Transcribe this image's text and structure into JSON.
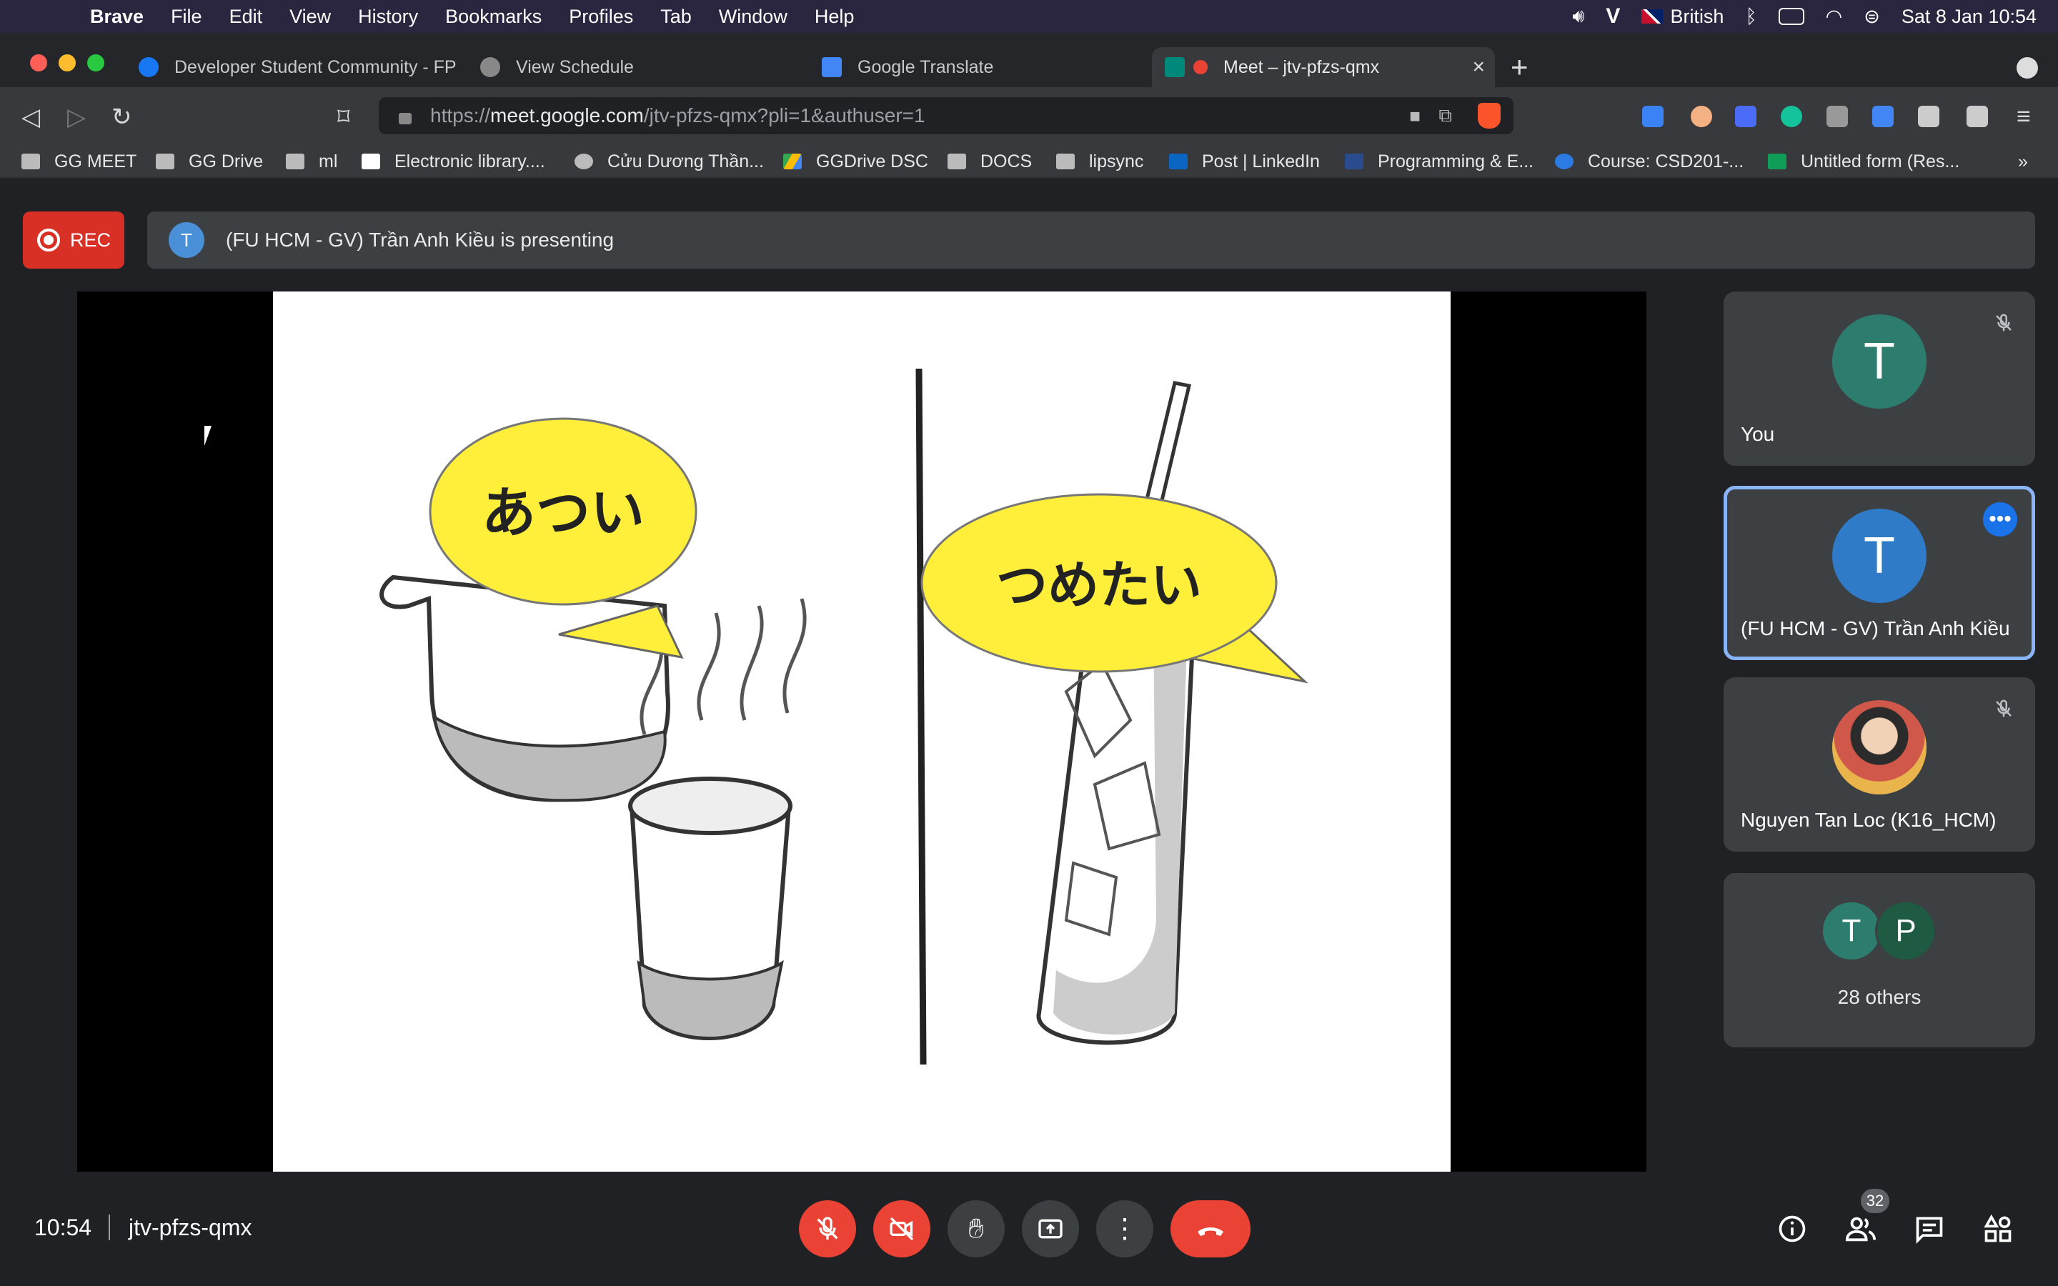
{
  "menubar": {
    "app": "Brave",
    "items": [
      "File",
      "Edit",
      "View",
      "History",
      "Bookmarks",
      "Profiles",
      "Tab",
      "Window",
      "Help"
    ],
    "language": "British",
    "datetime": "Sat 8 Jan  10:54"
  },
  "tabs": [
    {
      "title": "Developer Student Community - FP"
    },
    {
      "title": "View Schedule"
    },
    {
      "title": "Google Translate"
    },
    {
      "title": "Meet – jtv-pfzs-qmx"
    }
  ],
  "address": {
    "prefix": "https://",
    "host": "meet.google.com",
    "path": "/jtv-pfzs-qmx?pli=1&authuser=1"
  },
  "bookmarks": [
    {
      "label": "GG MEET"
    },
    {
      "label": "GG Drive"
    },
    {
      "label": "ml"
    },
    {
      "label": "Electronic library...."
    },
    {
      "label": "Cửu Dương Thần..."
    },
    {
      "label": "GGDrive DSC"
    },
    {
      "label": "DOCS"
    },
    {
      "label": "lipsync"
    },
    {
      "label": "Post | LinkedIn"
    },
    {
      "label": "Programming & E..."
    },
    {
      "label": "Course: CSD201-..."
    },
    {
      "label": "Untitled form (Res..."
    }
  ],
  "bookmarks_more": "»",
  "meet": {
    "rec_label": "REC",
    "presenter_initial": "T",
    "presenting_text": "(FU HCM - GV) Trần Anh Kiều is presenting",
    "slide": {
      "left_bubble": "あつい",
      "right_bubble": "つめたい"
    },
    "participants": [
      {
        "initial": "T",
        "name": "You",
        "color": "#2d7d6f"
      },
      {
        "initial": "T",
        "name": "(FU HCM - GV) Trần Anh Kiều",
        "color": "#2f7bc8"
      },
      {
        "initial": "",
        "name": "Nguyen Tan Loc (K16_HCM)",
        "color": ""
      }
    ],
    "others": {
      "initials": [
        "T",
        "P"
      ],
      "colors": [
        "#2d7d6f",
        "#1e5b42"
      ],
      "label": "28 others"
    },
    "time": "10:54",
    "meeting_code": "jtv-pfzs-qmx",
    "people_count": "32"
  }
}
